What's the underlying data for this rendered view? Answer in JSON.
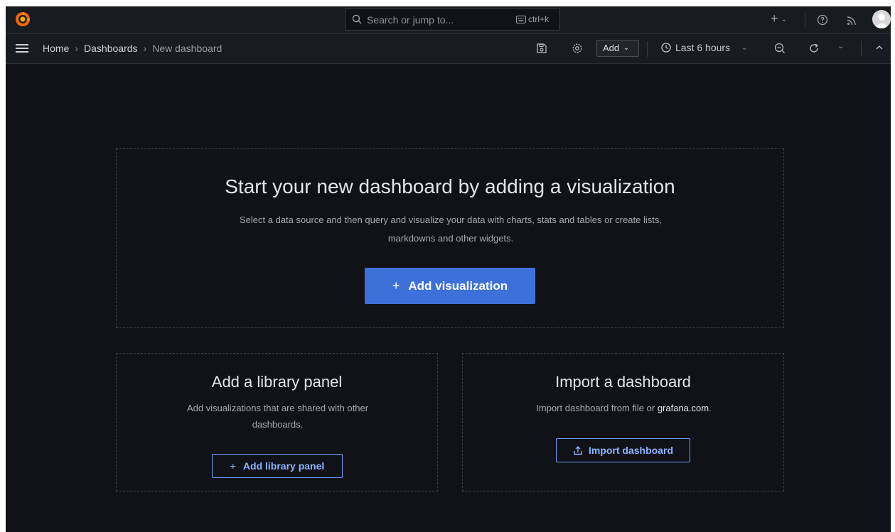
{
  "topbar": {
    "search_placeholder": "Search or jump to...",
    "search_shortcut": "ctrl+k",
    "new_icon": "plus-icon",
    "help_icon": "help-icon",
    "news_icon": "rss-icon"
  },
  "navbar": {
    "breadcrumbs": [
      "Home",
      "Dashboards",
      "New dashboard"
    ],
    "add_label": "Add",
    "time_range": "Last 6 hours"
  },
  "main": {
    "title": "Start your new dashboard by adding a visualization",
    "subtitle_line1": "Select a data source and then query and visualize your data with charts, stats and tables or create lists,",
    "subtitle_line2": "markdowns and other widgets.",
    "add_visualization_label": "Add visualization"
  },
  "library_panel": {
    "title": "Add a library panel",
    "description_line1": "Add visualizations that are shared with other",
    "description_line2": "dashboards.",
    "button_label": "Add library panel"
  },
  "import_dashboard": {
    "title": "Import a dashboard",
    "description_prefix": "Import dashboard from file or ",
    "description_link": "grafana.com",
    "description_suffix": ".",
    "button_label": "Import dashboard"
  },
  "colors": {
    "background": "#111217",
    "bar": "#181b1f",
    "primary": "#3d71d9",
    "link": "#8ab4ff",
    "logo": "#f46800"
  }
}
